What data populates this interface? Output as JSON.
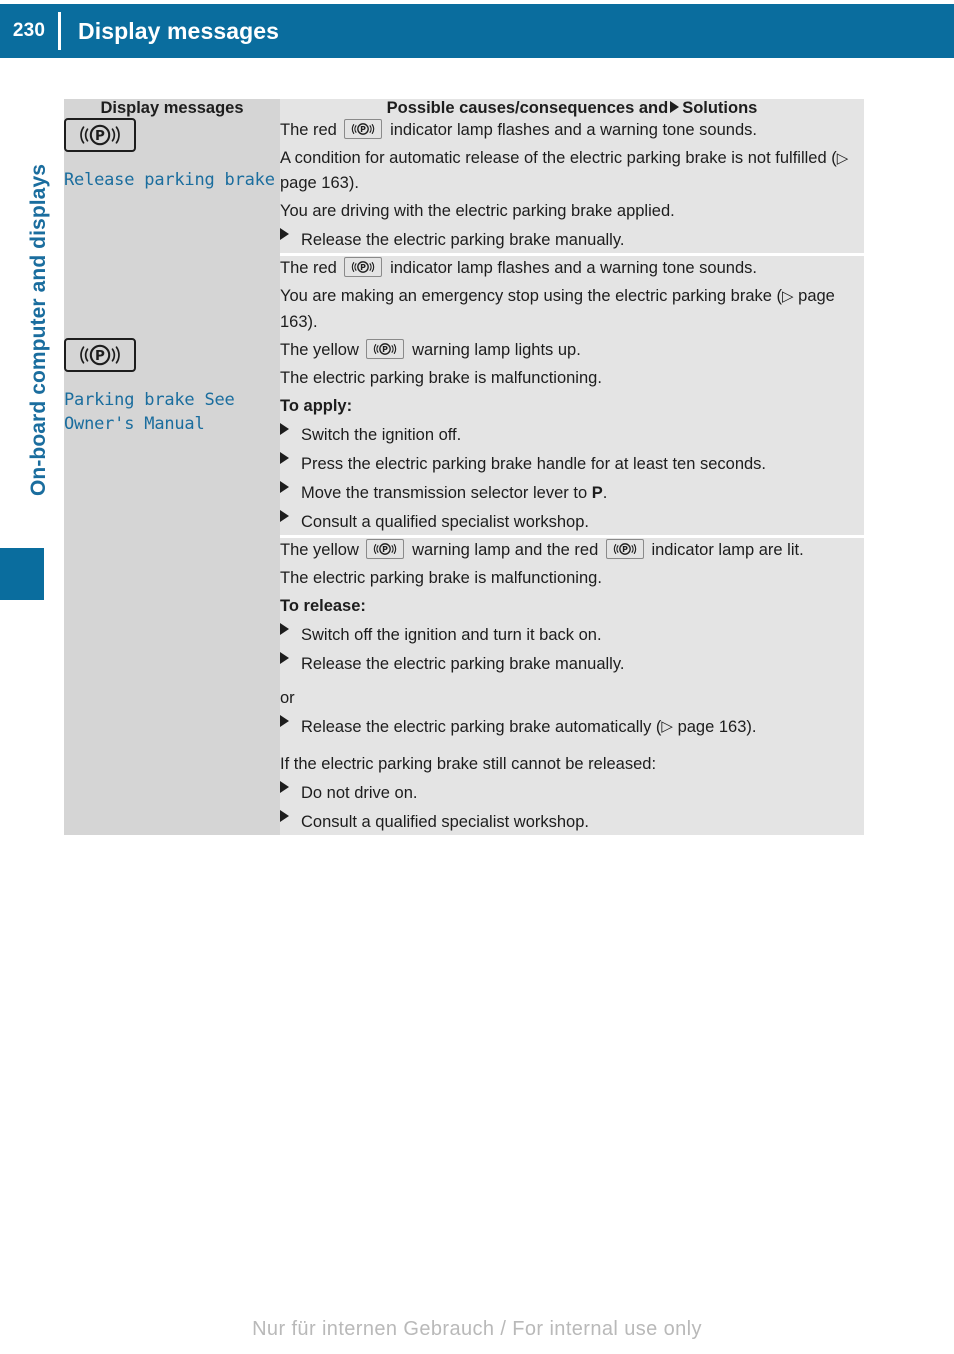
{
  "header": {
    "page_number": "230",
    "title": "Display messages",
    "accent_color": "#0a6d9e"
  },
  "sidebar": {
    "chapter_label": "On-board computer and displays",
    "tab_color": "#0a6d9e"
  },
  "table": {
    "columns": {
      "left_header": "Display messages",
      "right_header_before": "Possible causes/consequences and",
      "right_header_after": "Solutions"
    },
    "rows": [
      {
        "label": {
          "icon": "parking-brake-lamp-icon",
          "text": "Release parking brake",
          "color": "#1a6d9e"
        },
        "entries": [
          {
            "paragraphs": [
              {
                "type": "text-with-lamp",
                "before": "The red",
                "lamp": "parking-brake-lamp-icon",
                "after": "indicator lamp flashes and a warning tone sounds."
              },
              {
                "type": "text-with-ref",
                "before": "A condition for automatic release of the electric parking brake is not fulfilled (",
                "ref": "page 163",
                "after": ")."
              },
              {
                "type": "text",
                "text": "You are driving with the electric parking brake applied."
              }
            ],
            "steps": [
              {
                "type": "step",
                "text": "Release the electric parking brake manually."
              }
            ]
          },
          {
            "paragraphs": [
              {
                "type": "text-with-lamp",
                "before": "The red",
                "lamp": "parking-brake-lamp-icon",
                "after": "indicator lamp flashes and a warning tone sounds."
              },
              {
                "type": "text-with-ref",
                "before": "You are making an emergency stop using the electric parking brake (",
                "ref": "page 163",
                "after": ")."
              }
            ],
            "steps": []
          }
        ]
      },
      {
        "label": {
          "icon": "parking-brake-lamp-icon",
          "text": "Parking brake See Owner's Manual",
          "color": "#1a6d9e"
        },
        "entries": [
          {
            "paragraphs": [
              {
                "type": "text-with-lamp",
                "before": "The yellow",
                "lamp": "parking-brake-lamp-icon",
                "after": "warning lamp lights up."
              },
              {
                "type": "text",
                "text": "The electric parking brake is malfunctioning."
              },
              {
                "type": "bold",
                "text": "To apply:"
              }
            ],
            "steps": [
              {
                "type": "step",
                "text": "Switch the ignition off."
              },
              {
                "type": "step",
                "text": "Press the electric parking brake handle for at least ten seconds."
              },
              {
                "type": "step-bold-end",
                "before": "Move the transmission selector lever to ",
                "bold": "P",
                "after": "."
              },
              {
                "type": "step",
                "text": "Consult a qualified specialist workshop."
              }
            ]
          },
          {
            "paragraphs": [
              {
                "type": "text-with-two-lamps",
                "before": "The yellow",
                "lamp1": "parking-brake-lamp-icon",
                "middle": "warning lamp and the red",
                "lamp2": "parking-brake-lamp-icon",
                "after": "indicator lamp are lit."
              },
              {
                "type": "text",
                "text": "The electric parking brake is malfunctioning."
              },
              {
                "type": "bold",
                "text": "To release:"
              }
            ],
            "steps": [
              {
                "type": "step",
                "text": "Switch off the ignition and turn it back on."
              },
              {
                "type": "step",
                "text": "Release the electric parking brake manually."
              },
              {
                "type": "plain",
                "text": "or"
              },
              {
                "type": "step-with-ref",
                "before": "Release the electric parking brake automatically (",
                "ref": "page 163",
                "after": ")."
              },
              {
                "type": "plain-gap",
                "text": "If the electric parking brake still cannot be released:"
              },
              {
                "type": "step",
                "text": "Do not drive on."
              },
              {
                "type": "step",
                "text": "Consult a qualified specialist workshop."
              }
            ]
          }
        ]
      }
    ]
  },
  "footer": {
    "watermark": "Nur für internen Gebrauch / For internal use only"
  }
}
